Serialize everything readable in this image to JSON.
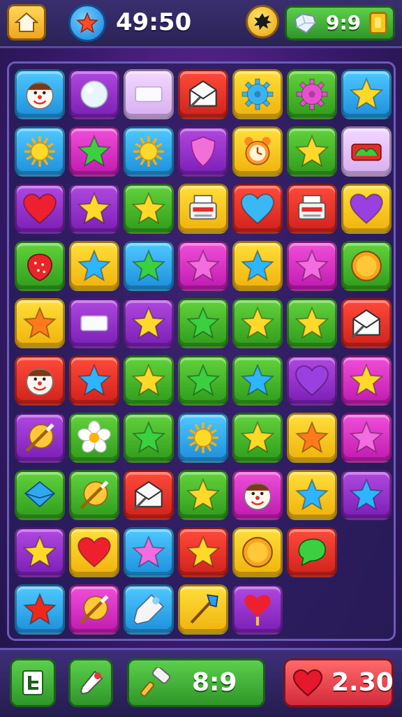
{
  "hud": {
    "timer": "49:50",
    "moves": "9:9",
    "hammer_count": "8:9",
    "lives": "2.30"
  },
  "board": {
    "rows": [
      [
        {
          "color": "blue",
          "icon": "clown-face"
        },
        {
          "color": "purple",
          "icon": "pearl"
        },
        {
          "color": "lilac",
          "icon": "white-bar"
        },
        {
          "color": "red",
          "icon": "envelope"
        },
        {
          "color": "yellow",
          "icon": "blue-gear"
        },
        {
          "color": "green",
          "icon": "pink-gear"
        },
        {
          "color": "blue",
          "icon": "star-yellow"
        }
      ],
      [
        {
          "color": "blue",
          "icon": "sun"
        },
        {
          "color": "pink",
          "icon": "star-green"
        },
        {
          "color": "blue",
          "icon": "sun"
        },
        {
          "color": "purple",
          "icon": "pink-shield"
        },
        {
          "color": "yellow",
          "icon": "alarm-clock"
        },
        {
          "color": "green",
          "icon": "star-yellow"
        },
        {
          "color": "lilac",
          "icon": "red-box"
        }
      ],
      [
        {
          "color": "purple",
          "icon": "heart-red"
        },
        {
          "color": "purple",
          "icon": "star-yellow"
        },
        {
          "color": "green",
          "icon": "star-yellow"
        },
        {
          "color": "yellow",
          "icon": "printer"
        },
        {
          "color": "red",
          "icon": "heart-blue"
        },
        {
          "color": "red",
          "icon": "printer"
        },
        {
          "color": "yellow",
          "icon": "heart-purple"
        }
      ],
      [
        {
          "color": "green",
          "icon": "strawberry"
        },
        {
          "color": "yellow",
          "icon": "star-blue"
        },
        {
          "color": "blue",
          "icon": "star-green"
        },
        {
          "color": "pink",
          "icon": "star-pink"
        },
        {
          "color": "yellow",
          "icon": "star-blue"
        },
        {
          "color": "pink",
          "icon": "star-pink"
        },
        {
          "color": "green",
          "icon": "orange-coin"
        }
      ],
      [
        {
          "color": "yellow",
          "icon": "star-orange"
        },
        {
          "color": "purple",
          "icon": "white-bar"
        },
        {
          "color": "purple",
          "icon": "star-yellow"
        },
        {
          "color": "green",
          "icon": "star-green"
        },
        {
          "color": "green",
          "icon": "star-yellow"
        },
        {
          "color": "green",
          "icon": "star-yellow"
        },
        {
          "color": "red",
          "icon": "envelope"
        }
      ],
      [
        {
          "color": "red",
          "icon": "clown-face"
        },
        {
          "color": "red",
          "icon": "star-blue"
        },
        {
          "color": "green",
          "icon": "star-yellow"
        },
        {
          "color": "green",
          "icon": "star-green"
        },
        {
          "color": "green",
          "icon": "star-blue"
        },
        {
          "color": "purple",
          "icon": "heart-purple"
        },
        {
          "color": "pink",
          "icon": "star-yellow"
        }
      ],
      [
        {
          "color": "purple",
          "icon": "sword"
        },
        {
          "color": "green",
          "icon": "flower"
        },
        {
          "color": "green",
          "icon": "star-green"
        },
        {
          "color": "blue",
          "icon": "sun"
        },
        {
          "color": "green",
          "icon": "star-yellow"
        },
        {
          "color": "yellow",
          "icon": "star-orange"
        },
        {
          "color": "pink",
          "icon": "star-pink"
        }
      ],
      [
        {
          "color": "green",
          "icon": "blue-gem"
        },
        {
          "color": "green",
          "icon": "sword"
        },
        {
          "color": "red",
          "icon": "envelope"
        },
        {
          "color": "green",
          "icon": "star-yellow"
        },
        {
          "color": "pink",
          "icon": "clown-face"
        },
        {
          "color": "yellow",
          "icon": "star-blue"
        },
        {
          "color": "purple",
          "icon": "star-blue"
        }
      ],
      [
        {
          "color": "purple",
          "icon": "star-yellow"
        },
        {
          "color": "yellow",
          "icon": "heart-red"
        },
        {
          "color": "blue",
          "icon": "star-pink"
        },
        {
          "color": "red",
          "icon": "star-yellow"
        },
        {
          "color": "yellow",
          "icon": "orange-coin"
        },
        {
          "color": "red",
          "icon": "green-bubble"
        }
      ],
      [
        {
          "color": "blue",
          "icon": "star-red"
        },
        {
          "color": "pink",
          "icon": "sword"
        },
        {
          "color": "blue",
          "icon": "flashlight"
        },
        {
          "color": "yellow",
          "icon": "shovel"
        },
        {
          "color": "purple",
          "icon": "heart-balloon"
        }
      ]
    ]
  }
}
